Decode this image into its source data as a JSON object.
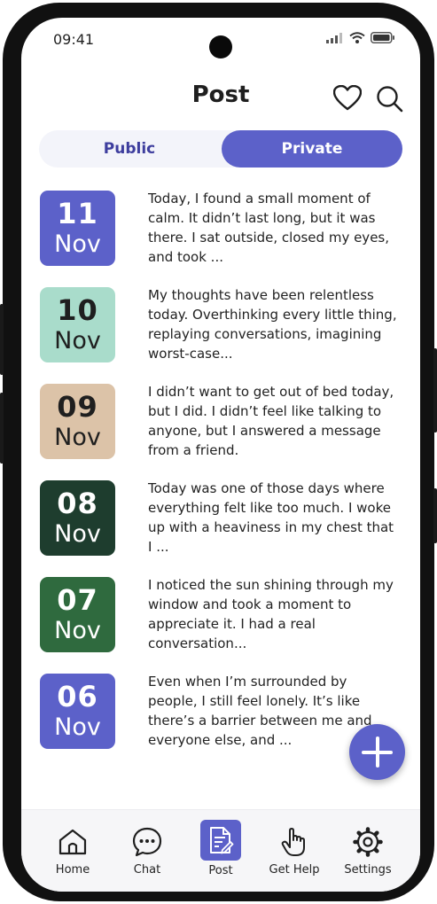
{
  "status": {
    "time": "09:41"
  },
  "header": {
    "title": "Post"
  },
  "tabs": {
    "public": "Public",
    "private": "Private",
    "selected": "Private"
  },
  "entries": [
    {
      "day": "11",
      "month": "Nov",
      "color": "#5c61c9",
      "text_color": "#ffffff",
      "preview": "Today, I found a small moment of calm. It didn’t last long, but it was there. I sat outside, closed my eyes, and took ..."
    },
    {
      "day": "10",
      "month": "Nov",
      "color": "#a9dccb",
      "text_color": "#1f1f1f",
      "preview": "My thoughts have been relentless today. Overthinking every little thing, replaying conversations, imagining worst-case..."
    },
    {
      "day": "09",
      "month": "Nov",
      "color": "#dcc3a8",
      "text_color": "#1f1f1f",
      "preview": "I didn’t want to get out of bed today, but I did. I didn’t feel like talking to anyone, but I answered a message from a friend."
    },
    {
      "day": "08",
      "month": "Nov",
      "color": "#1e3d2e",
      "text_color": "#ffffff",
      "preview": "Today was one of those days where everything felt like too much. I woke up with a heaviness in my chest that I ..."
    },
    {
      "day": "07",
      "month": "Nov",
      "color": "#2f6a3e",
      "text_color": "#ffffff",
      "preview": "I noticed the sun shining through my window and took a moment to appreciate it. I had a real conversation..."
    },
    {
      "day": "06",
      "month": "Nov",
      "color": "#5c61c9",
      "text_color": "#ffffff",
      "preview": "Even when I’m surrounded by people, I still feel lonely. It’s like there’s a barrier between me and everyone else, and ..."
    }
  ],
  "nav": {
    "home": "Home",
    "chat": "Chat",
    "post": "Post",
    "get_help": "Get Help",
    "settings": "Settings",
    "active": "Post"
  },
  "colors": {
    "accent": "#5c61c9",
    "accent_text": "#3e3e9e"
  }
}
